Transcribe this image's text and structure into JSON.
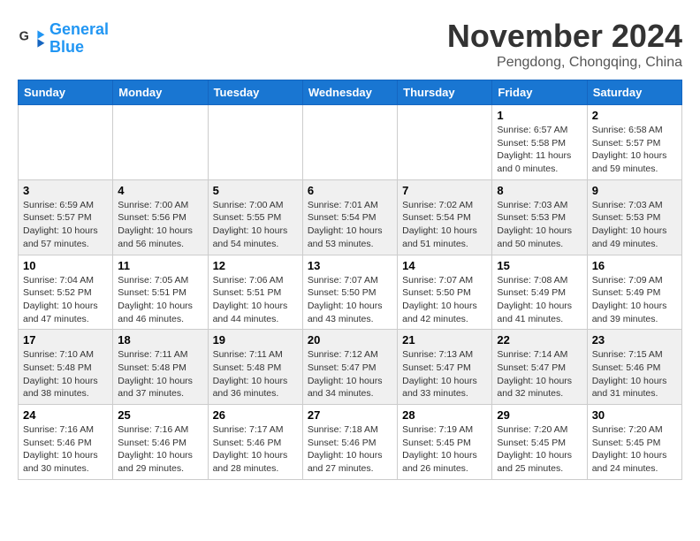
{
  "logo": {
    "line1": "General",
    "line2": "Blue"
  },
  "title": "November 2024",
  "subtitle": "Pengdong, Chongqing, China",
  "weekdays": [
    "Sunday",
    "Monday",
    "Tuesday",
    "Wednesday",
    "Thursday",
    "Friday",
    "Saturday"
  ],
  "weeks": [
    [
      {
        "day": "",
        "info": ""
      },
      {
        "day": "",
        "info": ""
      },
      {
        "day": "",
        "info": ""
      },
      {
        "day": "",
        "info": ""
      },
      {
        "day": "",
        "info": ""
      },
      {
        "day": "1",
        "info": "Sunrise: 6:57 AM\nSunset: 5:58 PM\nDaylight: 11 hours\nand 0 minutes."
      },
      {
        "day": "2",
        "info": "Sunrise: 6:58 AM\nSunset: 5:57 PM\nDaylight: 10 hours\nand 59 minutes."
      }
    ],
    [
      {
        "day": "3",
        "info": "Sunrise: 6:59 AM\nSunset: 5:57 PM\nDaylight: 10 hours\nand 57 minutes."
      },
      {
        "day": "4",
        "info": "Sunrise: 7:00 AM\nSunset: 5:56 PM\nDaylight: 10 hours\nand 56 minutes."
      },
      {
        "day": "5",
        "info": "Sunrise: 7:00 AM\nSunset: 5:55 PM\nDaylight: 10 hours\nand 54 minutes."
      },
      {
        "day": "6",
        "info": "Sunrise: 7:01 AM\nSunset: 5:54 PM\nDaylight: 10 hours\nand 53 minutes."
      },
      {
        "day": "7",
        "info": "Sunrise: 7:02 AM\nSunset: 5:54 PM\nDaylight: 10 hours\nand 51 minutes."
      },
      {
        "day": "8",
        "info": "Sunrise: 7:03 AM\nSunset: 5:53 PM\nDaylight: 10 hours\nand 50 minutes."
      },
      {
        "day": "9",
        "info": "Sunrise: 7:03 AM\nSunset: 5:53 PM\nDaylight: 10 hours\nand 49 minutes."
      }
    ],
    [
      {
        "day": "10",
        "info": "Sunrise: 7:04 AM\nSunset: 5:52 PM\nDaylight: 10 hours\nand 47 minutes."
      },
      {
        "day": "11",
        "info": "Sunrise: 7:05 AM\nSunset: 5:51 PM\nDaylight: 10 hours\nand 46 minutes."
      },
      {
        "day": "12",
        "info": "Sunrise: 7:06 AM\nSunset: 5:51 PM\nDaylight: 10 hours\nand 44 minutes."
      },
      {
        "day": "13",
        "info": "Sunrise: 7:07 AM\nSunset: 5:50 PM\nDaylight: 10 hours\nand 43 minutes."
      },
      {
        "day": "14",
        "info": "Sunrise: 7:07 AM\nSunset: 5:50 PM\nDaylight: 10 hours\nand 42 minutes."
      },
      {
        "day": "15",
        "info": "Sunrise: 7:08 AM\nSunset: 5:49 PM\nDaylight: 10 hours\nand 41 minutes."
      },
      {
        "day": "16",
        "info": "Sunrise: 7:09 AM\nSunset: 5:49 PM\nDaylight: 10 hours\nand 39 minutes."
      }
    ],
    [
      {
        "day": "17",
        "info": "Sunrise: 7:10 AM\nSunset: 5:48 PM\nDaylight: 10 hours\nand 38 minutes."
      },
      {
        "day": "18",
        "info": "Sunrise: 7:11 AM\nSunset: 5:48 PM\nDaylight: 10 hours\nand 37 minutes."
      },
      {
        "day": "19",
        "info": "Sunrise: 7:11 AM\nSunset: 5:48 PM\nDaylight: 10 hours\nand 36 minutes."
      },
      {
        "day": "20",
        "info": "Sunrise: 7:12 AM\nSunset: 5:47 PM\nDaylight: 10 hours\nand 34 minutes."
      },
      {
        "day": "21",
        "info": "Sunrise: 7:13 AM\nSunset: 5:47 PM\nDaylight: 10 hours\nand 33 minutes."
      },
      {
        "day": "22",
        "info": "Sunrise: 7:14 AM\nSunset: 5:47 PM\nDaylight: 10 hours\nand 32 minutes."
      },
      {
        "day": "23",
        "info": "Sunrise: 7:15 AM\nSunset: 5:46 PM\nDaylight: 10 hours\nand 31 minutes."
      }
    ],
    [
      {
        "day": "24",
        "info": "Sunrise: 7:16 AM\nSunset: 5:46 PM\nDaylight: 10 hours\nand 30 minutes."
      },
      {
        "day": "25",
        "info": "Sunrise: 7:16 AM\nSunset: 5:46 PM\nDaylight: 10 hours\nand 29 minutes."
      },
      {
        "day": "26",
        "info": "Sunrise: 7:17 AM\nSunset: 5:46 PM\nDaylight: 10 hours\nand 28 minutes."
      },
      {
        "day": "27",
        "info": "Sunrise: 7:18 AM\nSunset: 5:46 PM\nDaylight: 10 hours\nand 27 minutes."
      },
      {
        "day": "28",
        "info": "Sunrise: 7:19 AM\nSunset: 5:45 PM\nDaylight: 10 hours\nand 26 minutes."
      },
      {
        "day": "29",
        "info": "Sunrise: 7:20 AM\nSunset: 5:45 PM\nDaylight: 10 hours\nand 25 minutes."
      },
      {
        "day": "30",
        "info": "Sunrise: 7:20 AM\nSunset: 5:45 PM\nDaylight: 10 hours\nand 24 minutes."
      }
    ]
  ]
}
